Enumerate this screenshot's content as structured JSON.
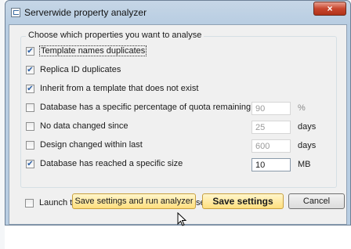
{
  "window": {
    "title": "Serverwide property analyzer",
    "close_label": "×"
  },
  "group": {
    "legend": "Choose which properties you want to analyse",
    "rows": [
      {
        "label": "Template names duplicates",
        "checked": true
      },
      {
        "label": "Replica ID duplicates",
        "checked": true
      },
      {
        "label": "Inherit from a template that does not exist",
        "checked": true
      },
      {
        "label": "Database has a specific percentage of quota remaining",
        "checked": false,
        "value": "90",
        "unit": "%"
      },
      {
        "label": "No data changed since",
        "checked": false,
        "value": "25",
        "unit": "days"
      },
      {
        "label": "Design changed within last",
        "checked": false,
        "value": "600",
        "unit": "days"
      },
      {
        "label": "Database has reached a specific size",
        "checked": true,
        "value": "10",
        "unit": "MB"
      }
    ]
  },
  "launch": {
    "label": "Launch the analyzer on startup of databaseEZ",
    "checked": false
  },
  "buttons": {
    "save_run": "Save settings and run analyzer",
    "save": "Save settings",
    "cancel": "Cancel"
  },
  "check_glyph": "✔",
  "icons": [
    "app-icon",
    "close-icon",
    "mouse-cursor-icon"
  ]
}
